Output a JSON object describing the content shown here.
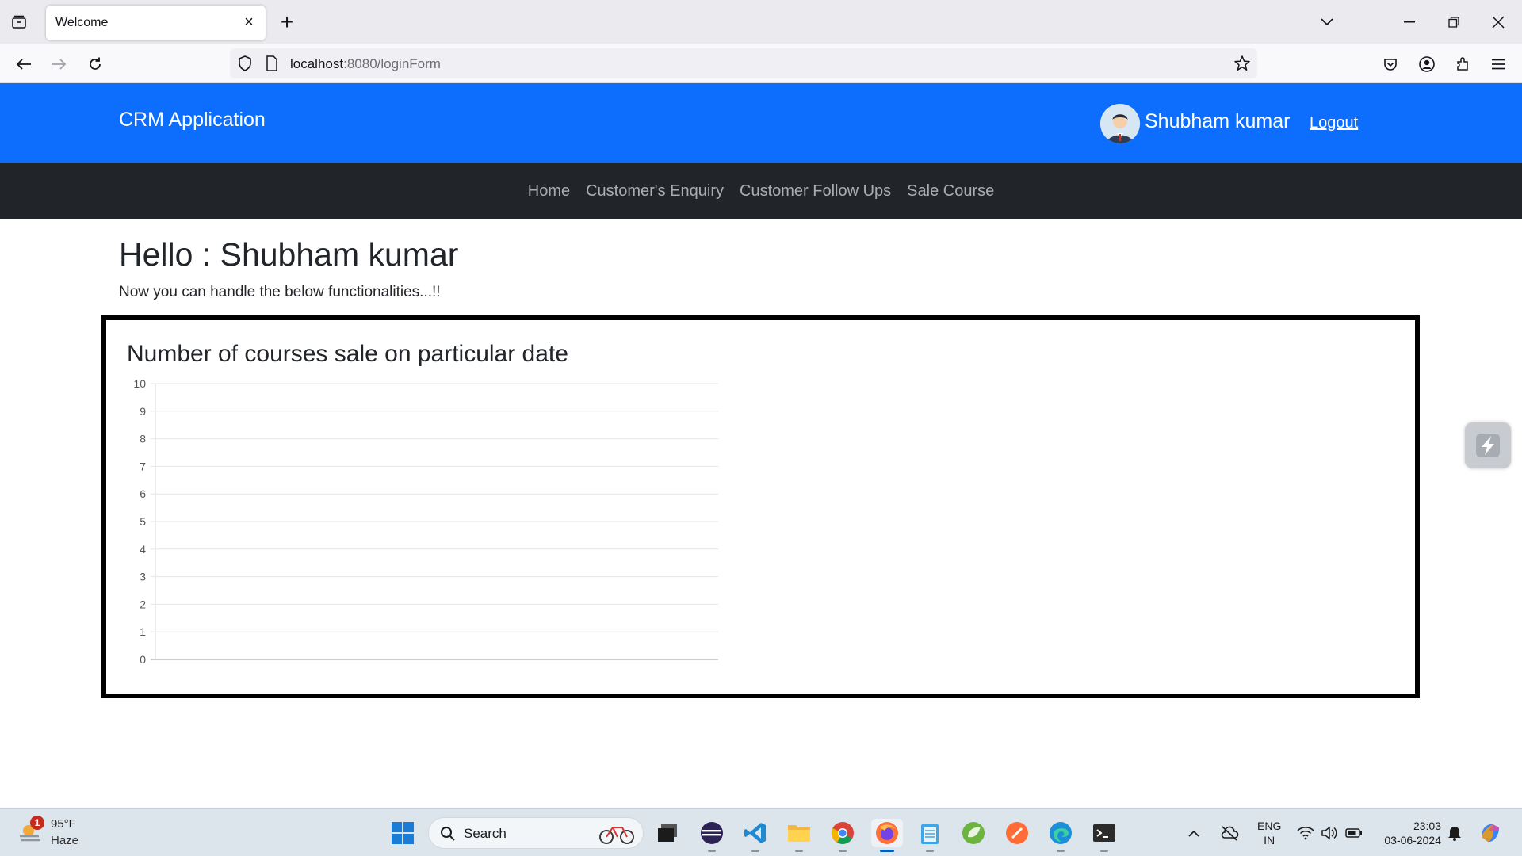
{
  "browser": {
    "tab_title": "Welcome",
    "url_host": "localhost",
    "url_rest": ":8080/loginForm"
  },
  "header": {
    "brand": "CRM Application",
    "user_name": "Shubham kumar",
    "logout": "Logout"
  },
  "nav": {
    "items": [
      "Home",
      "Customer's Enquiry",
      "Customer Follow Ups",
      "Sale Course"
    ]
  },
  "main": {
    "greeting": "Hello : Shubham kumar",
    "subtitle": "Now you can handle the below functionalities...!!"
  },
  "chart_data": {
    "type": "bar",
    "title": "Number of courses sale on particular date",
    "categories": [],
    "values": [],
    "ylim": [
      0,
      10
    ],
    "yticks": [
      "0",
      "1",
      "2",
      "3",
      "4",
      "5",
      "6",
      "7",
      "8",
      "9",
      "10"
    ],
    "grid": true
  },
  "taskbar": {
    "weather_temp": "95°F",
    "weather_cond": "Haze",
    "weather_badge": "1",
    "search_label": "Search",
    "lang_top": "ENG",
    "lang_bottom": "IN",
    "time": "23:03",
    "date": "03-06-2024"
  },
  "colors": {
    "header_bg": "#0d6efd",
    "nav_bg": "#212529",
    "chart_border": "#000000"
  }
}
